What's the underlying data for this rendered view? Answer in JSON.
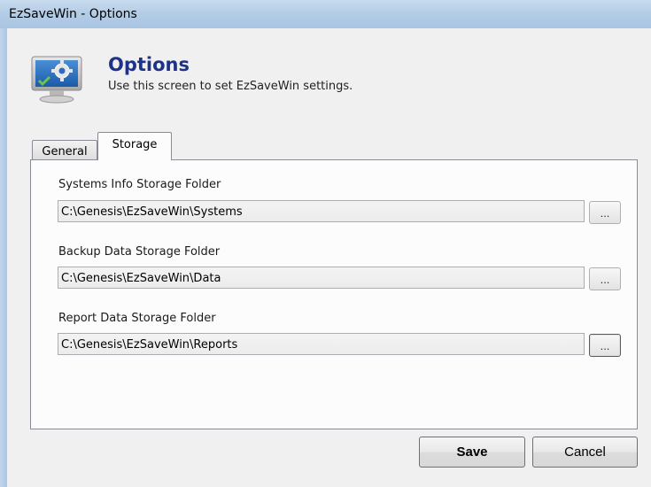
{
  "window": {
    "title": "EzSaveWin - Options"
  },
  "header": {
    "title": "Options",
    "subtitle": "Use this screen to set EzSaveWin settings.",
    "icon": "monitor-settings-icon"
  },
  "tabs": [
    {
      "label": "General",
      "active": false
    },
    {
      "label": "Storage",
      "active": true
    }
  ],
  "storage": {
    "fields": [
      {
        "label": "Systems Info Storage Folder",
        "value": "C:\\Genesis\\EzSaveWin\\Systems",
        "browse_label": "..."
      },
      {
        "label": "Backup Data Storage Folder",
        "value": "C:\\Genesis\\EzSaveWin\\Data",
        "browse_label": "..."
      },
      {
        "label": "Report Data Storage Folder",
        "value": "C:\\Genesis\\EzSaveWin\\Reports",
        "browse_label": "..."
      }
    ]
  },
  "buttons": {
    "save": "Save",
    "cancel": "Cancel"
  },
  "colors": {
    "title": "#1e3287",
    "titlebar": "#b4cde6",
    "panel": "#fcfcfc",
    "background": "#f0f0f0"
  }
}
